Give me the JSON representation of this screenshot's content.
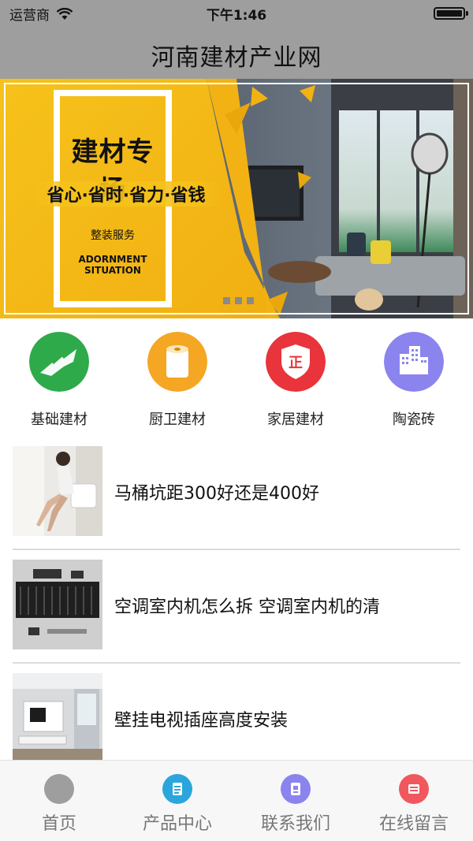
{
  "status_bar": {
    "carrier": "运营商",
    "time": "下午1:46"
  },
  "header": {
    "title": "河南建材产业网"
  },
  "banner": {
    "title": "建材专场",
    "slogan": "省心·省时·省力·省钱",
    "service": "整装服务",
    "english": "ADORNMENT SITUATION",
    "slides": 3,
    "active_slide": 1
  },
  "categories": [
    {
      "label": "基础建材",
      "icon": "plane-leaf-icon",
      "color": "#2eaa4a"
    },
    {
      "label": "厨卫建材",
      "icon": "paper-roll-icon",
      "color": "#f5a623"
    },
    {
      "label": "家居建材",
      "icon": "shield-zheng-icon",
      "color": "#e8343a"
    },
    {
      "label": "陶瓷砖",
      "icon": "buildings-icon",
      "color": "#8b84ee"
    }
  ],
  "news": [
    {
      "title": "马桶坑距300好还是400好"
    },
    {
      "title": "空调室内机怎么拆 空调室内机的清"
    },
    {
      "title": "壁挂电视插座高度安装"
    }
  ],
  "tabbar": {
    "items": [
      {
        "label": "首页",
        "icon": "home-dot-icon",
        "color": "#9e9e9e"
      },
      {
        "label": "产品中心",
        "icon": "document-icon",
        "color": "#2aa6dc"
      },
      {
        "label": "联系我们",
        "icon": "notebook-icon",
        "color": "#8b84ee"
      },
      {
        "label": "在线留言",
        "icon": "message-icon",
        "color": "#f0585e"
      }
    ]
  }
}
